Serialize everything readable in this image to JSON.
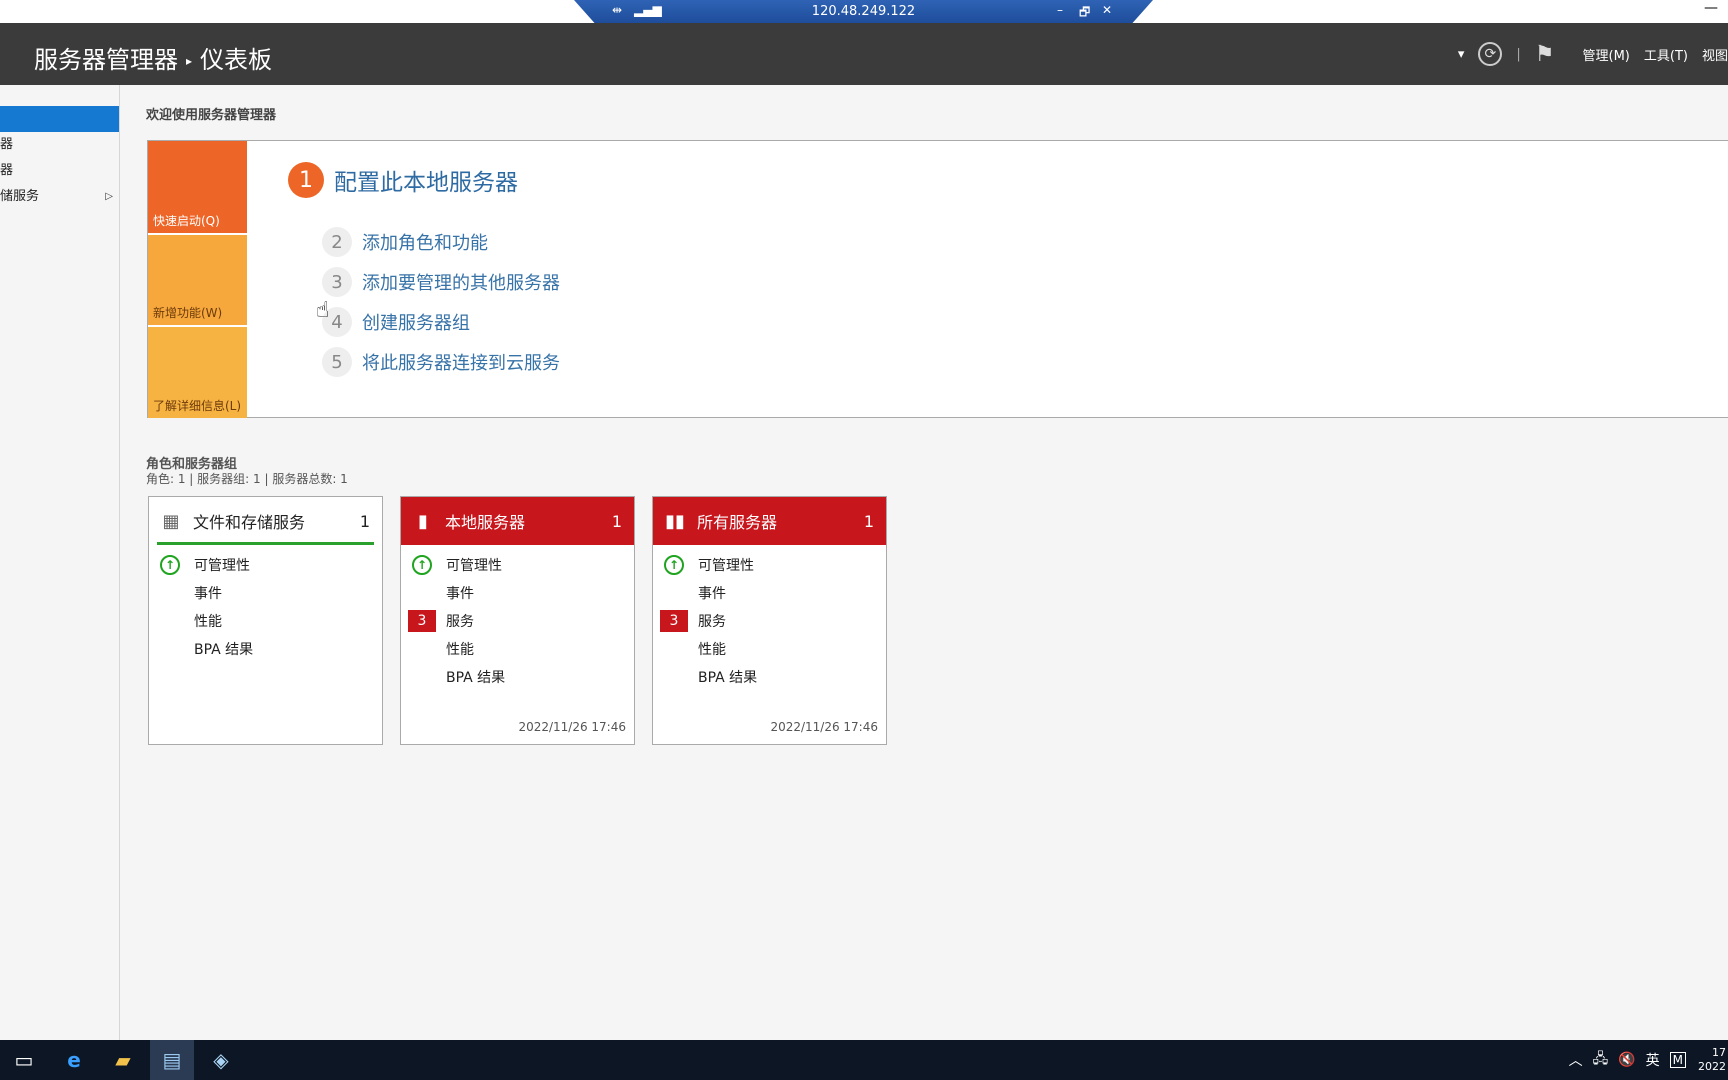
{
  "rdp": {
    "ip": "120.48.249.122",
    "pin_icon": "pin-icon",
    "signal_icon": "signal-icon",
    "min": "–",
    "restore": "🗗",
    "close": "✕"
  },
  "window": {
    "min": "—"
  },
  "header": {
    "app": "服务器管理器",
    "sep": "▸",
    "page": "仪表板",
    "dropdown": "▾",
    "refresh": "⟳",
    "divider": "|",
    "flag": "⚑",
    "manage": "管理(M)",
    "tools": "工具(T)",
    "view": "视图"
  },
  "sidebar": {
    "items": [
      {
        "label": ""
      },
      {
        "label": "器"
      },
      {
        "label": "器"
      },
      {
        "label": "储服务",
        "arrow": "▷"
      }
    ]
  },
  "welcome": {
    "title": "欢迎使用服务器管理器",
    "tiles": {
      "quickstart": "快速启动(Q)",
      "whatsnew": "新增功能(W)",
      "learnmore": "了解详细信息(L)"
    },
    "step1": {
      "num": "1",
      "label": "配置此本地服务器"
    },
    "steps": [
      {
        "num": "2",
        "label": "添加角色和功能"
      },
      {
        "num": "3",
        "label": "添加要管理的其他服务器"
      },
      {
        "num": "4",
        "label": "创建服务器组"
      },
      {
        "num": "5",
        "label": "将此服务器连接到云服务"
      }
    ]
  },
  "roles": {
    "title": "角色和服务器组",
    "summary": "角色: 1 | 服务器组: 1 | 服务器总数: 1",
    "cards": [
      {
        "title": "文件和存储服务",
        "count": "1",
        "rows": [
          "可管理性",
          "事件",
          "性能",
          "BPA 结果"
        ]
      },
      {
        "title": "本地服务器",
        "count": "1",
        "rows": [
          "可管理性",
          "事件",
          "服务",
          "性能",
          "BPA 结果"
        ],
        "badge": "3",
        "time": "2022/11/26 17:46"
      },
      {
        "title": "所有服务器",
        "count": "1",
        "rows": [
          "可管理性",
          "事件",
          "服务",
          "性能",
          "BPA 结果"
        ],
        "badge": "3",
        "time": "2022/11/26 17:46"
      }
    ]
  },
  "taskbar": {
    "tray": {
      "ime": "英",
      "m": "M",
      "time": "17",
      "date": "2022"
    }
  },
  "colors": {
    "accent": "#1579d1",
    "orange": "#ee6627",
    "red": "#c8161d",
    "green": "#1fa41f"
  }
}
